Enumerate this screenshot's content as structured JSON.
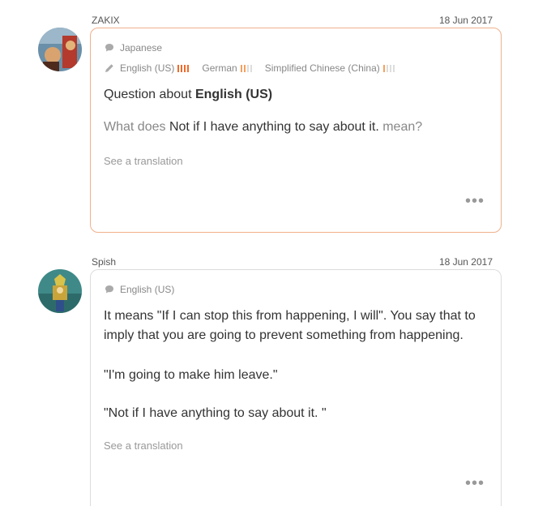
{
  "posts": [
    {
      "author": "ZAKIX",
      "date": "18 Jun 2017",
      "native_language": "Japanese",
      "languages": [
        {
          "name": "English (US)",
          "level": 4
        },
        {
          "name": "German",
          "level": 2
        },
        {
          "name": "Simplified Chinese (China)",
          "level": 1
        }
      ],
      "question_prefix": "Question about ",
      "question_language": "English (US)",
      "body_prefix": "What does ",
      "body_phrase": "Not if I have anything to say about it.",
      "body_suffix": " mean?",
      "see_translation": "See a translation",
      "more": "•••"
    },
    {
      "author": "Spish",
      "date": "18 Jun 2017",
      "native_language": "English (US)",
      "paragraphs": [
        "It means \"If I can stop this from happening, I will\". You say that to imply that you are going to prevent something from happening.",
        "\"I'm going to make him leave.\"",
        "\"Not if I have anything to say about it. \""
      ],
      "see_translation": "See a translation",
      "more": "•••"
    }
  ],
  "colors": {
    "question_border": "#f0b08c",
    "answer_border": "#dcdcdc",
    "level_high": "#f06a2a",
    "level_mid": "#f6a05d"
  }
}
